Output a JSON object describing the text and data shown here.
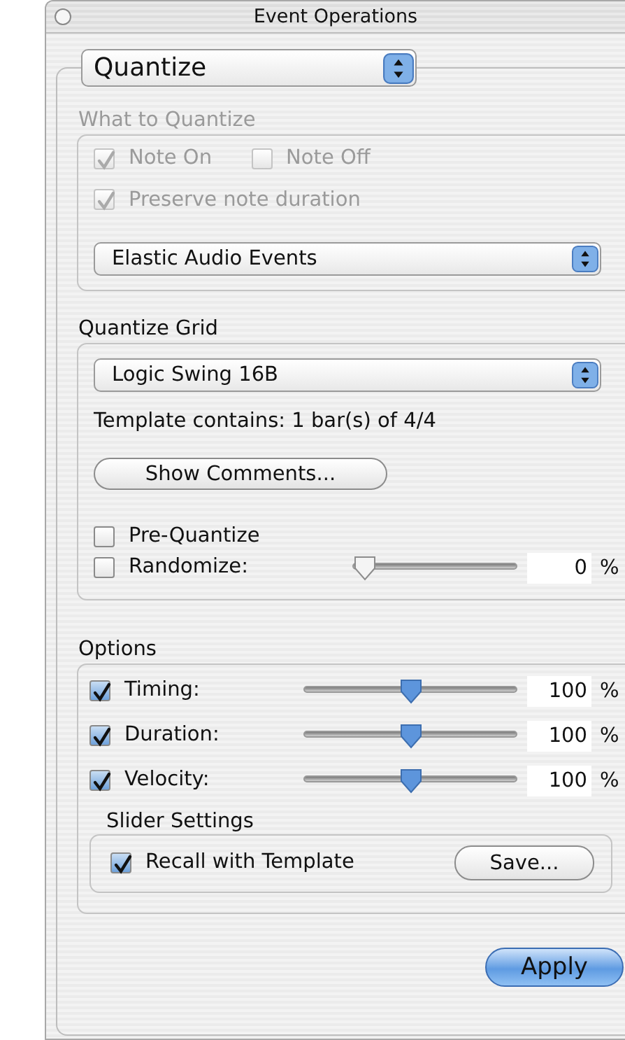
{
  "window": {
    "title": "Event Operations"
  },
  "operation_popup": {
    "value": "Quantize"
  },
  "what_to_quantize": {
    "title": "What to Quantize",
    "disabled": true,
    "checkboxes": [
      {
        "label": "Note On",
        "checked": true
      },
      {
        "label": "Note Off",
        "checked": false
      },
      {
        "label": "Preserve note duration",
        "checked": true
      }
    ],
    "popup": {
      "value": "Elastic Audio Events"
    }
  },
  "quantize_grid": {
    "title": "Quantize Grid",
    "popup": {
      "value": "Logic Swing 16B"
    },
    "template_info": "Template contains: 1 bar(s) of 4/4",
    "show_comments_button": "Show Comments...",
    "pre_quantize": {
      "label": "Pre-Quantize",
      "checked": false
    },
    "randomize": {
      "label": "Randomize:",
      "checked": false,
      "level": 0,
      "value": "0",
      "unit": "%"
    }
  },
  "options": {
    "title": "Options",
    "rows": [
      {
        "label": "Timing:",
        "checked": true,
        "level": 0.5,
        "value": "100",
        "unit": "%"
      },
      {
        "label": "Duration:",
        "checked": true,
        "level": 0.5,
        "value": "100",
        "unit": "%"
      },
      {
        "label": "Velocity:",
        "checked": true,
        "level": 0.5,
        "value": "100",
        "unit": "%"
      }
    ],
    "slider_settings": {
      "title": "Slider Settings",
      "recall": {
        "label": "Recall with Template",
        "checked": true
      },
      "save_button": "Save..."
    }
  },
  "apply_button": "Apply"
}
